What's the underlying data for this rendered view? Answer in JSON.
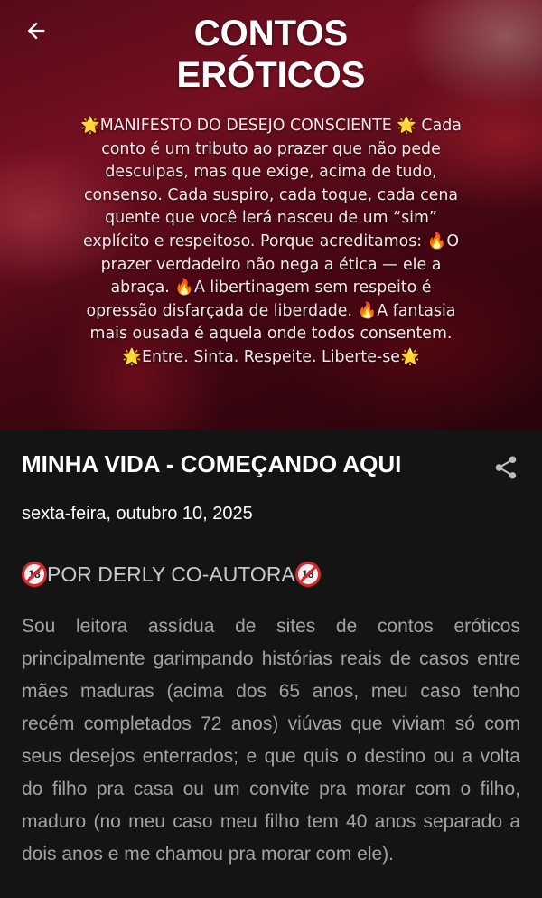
{
  "header": {
    "title_line1": "CONTOS",
    "title_line2": "ERÓTICOS",
    "description": "🌟MANIFESTO DO DESEJO CONSCIENTE 🌟 Cada conto é um tributo ao prazer que não pede desculpas, mas que exige, acima de tudo, consenso. Cada suspiro, cada toque, cada cena quente que você lerá nasceu de um “sim” explícito e respeitoso. Porque acreditamos: 🔥O prazer verdadeiro não nega a ética — ele a abraça. 🔥A libertinagem sem respeito é opressão disfarçada de liberdade. 🔥A fantasia mais ousada é aquela onde todos consentem. 🌟Entre. Sinta. Respeite. Liberte-se🌟",
    "back_icon": "arrow-left-icon"
  },
  "post": {
    "title": "MINHA VIDA - COMEÇANDO AQUI",
    "date": "sexta-feira, outubro 10, 2025",
    "subheading": "POR DERLY CO-AUTORA",
    "badge_text": "18",
    "body": "Sou leitora assídua de sites de contos eróticos principalmente garimpando histórias reais de casos entre mães maduras (acima dos 65 anos, meu caso tenho recém completados 72 anos) viúvas que viviam só com seus desejos enterrados; e que quis o destino ou a volta do filho pra casa ou um convite pra morar com o filho, maduro (no meu caso meu filho tem 40 anos separado a dois anos e me chamou pra morar com ele).",
    "share_icon": "share-icon"
  },
  "colors": {
    "background": "#141414",
    "title": "#ffffff",
    "body_text": "#a3a3a3",
    "badge_red": "#d8282f"
  }
}
